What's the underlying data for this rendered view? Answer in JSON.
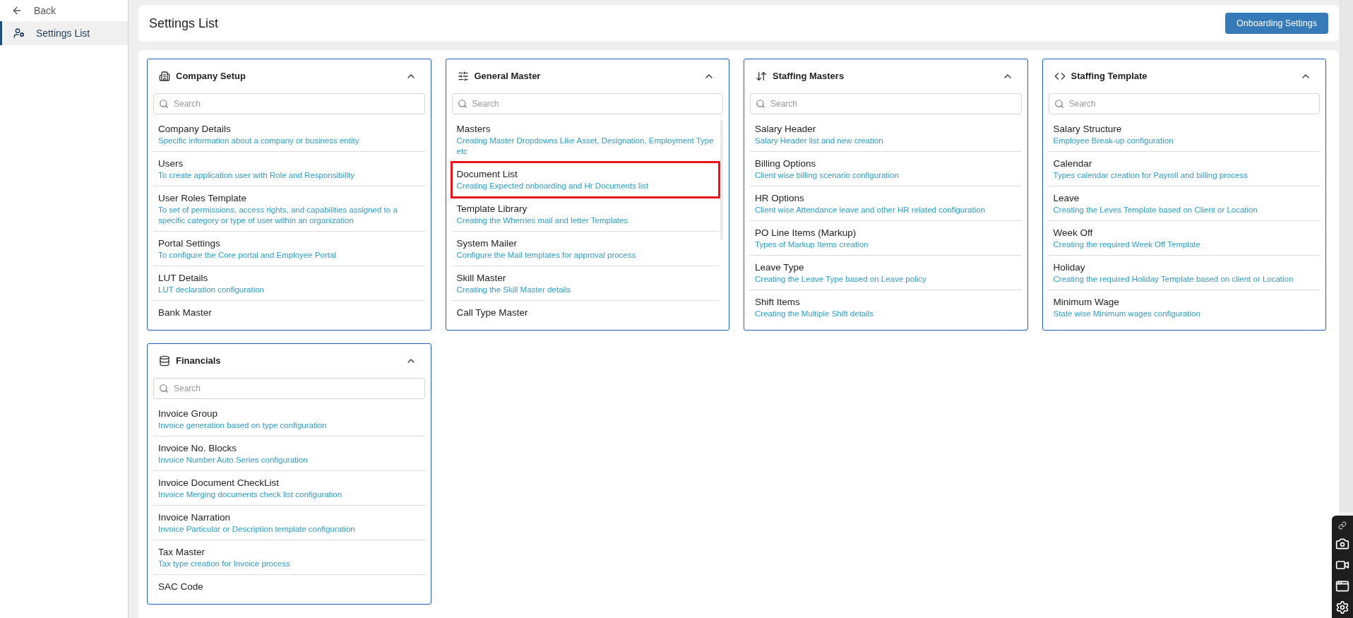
{
  "sidebar": {
    "back": "Back",
    "items": [
      {
        "label": "Settings List",
        "selected": true
      }
    ]
  },
  "header": {
    "title": "Settings List",
    "button": "Onboarding Settings"
  },
  "cards": [
    {
      "title": "Company Setup",
      "expanded": true,
      "scrollable": false,
      "search": {
        "placeholder": "Search"
      },
      "items": [
        {
          "title": "Company Details",
          "description": "Specific information about a company or business entity",
          "highlighted": false
        },
        {
          "title": "Users",
          "description": "To create application user with Role and Responsibility",
          "highlighted": false
        },
        {
          "title": "User Roles Template",
          "description": "To set of permissions, access rights, and capabilities assigned to a specific category or type of user within an organization",
          "highlighted": false
        },
        {
          "title": "Portal Settings",
          "description": "To configure the Core portal and Employee Portal",
          "highlighted": false
        },
        {
          "title": "LUT Details",
          "description": "LUT declaration configuration",
          "highlighted": false
        },
        {
          "title": "Bank Master",
          "highlighted": false
        }
      ]
    },
    {
      "title": "General Master",
      "expanded": true,
      "scrollable": true,
      "search": {
        "placeholder": "Search"
      },
      "items": [
        {
          "title": "Masters",
          "description": "Creating Master Dropdowns Like Asset, Designation, Employment Type etc",
          "highlighted": false
        },
        {
          "title": "Document List",
          "description": "Creating Expected onboarding and Hr Documents list",
          "highlighted": true
        },
        {
          "title": "Template Library",
          "description": "Creating the Wherries mail and letter Templates",
          "highlighted": false
        },
        {
          "title": "System Mailer",
          "description": "Configure the Mail templates for approval process",
          "highlighted": false
        },
        {
          "title": "Skill Master",
          "description": "Creating the Skill Master details",
          "highlighted": false
        },
        {
          "title": "Call Type Master",
          "highlighted": false
        }
      ]
    },
    {
      "title": "Staffing Masters",
      "expanded": true,
      "scrollable": false,
      "search": {
        "placeholder": "Search"
      },
      "items": [
        {
          "title": "Salary Header",
          "description": "Salary Header list and new creation",
          "highlighted": false
        },
        {
          "title": "Billing Options",
          "description": "Client wise billing scenario configuration",
          "highlighted": false
        },
        {
          "title": "HR Options",
          "description": "Client wise Attendance leave and other HR related configuration",
          "highlighted": false
        },
        {
          "title": "PO Line Items (Markup)",
          "description": "Types of Markup Items creation",
          "highlighted": false
        },
        {
          "title": "Leave Type",
          "description": "Creating the Leave Type based on Leave policy",
          "highlighted": false
        },
        {
          "title": "Shift Items",
          "description": "Creating the Multiple Shift details",
          "highlighted": false
        }
      ]
    },
    {
      "title": "Staffing Template",
      "expanded": true,
      "scrollable": false,
      "search": {
        "placeholder": "Search"
      },
      "items": [
        {
          "title": "Salary Structure",
          "description": "Employee Break-up configuration",
          "highlighted": false
        },
        {
          "title": "Calendar",
          "description": "Types calendar creation for Payroll and billing process",
          "highlighted": false
        },
        {
          "title": "Leave",
          "description": "Creating the Leves Template based on Client or Location",
          "highlighted": false
        },
        {
          "title": "Week Off",
          "description": "Creating the required Week Off Template",
          "highlighted": false
        },
        {
          "title": "Holiday",
          "description": "Creating the required Holiday Template based on client or Location",
          "highlighted": false
        },
        {
          "title": "Minimum Wage",
          "description": "State wise Minimum wages configuration",
          "highlighted": false
        }
      ]
    },
    {
      "title": "Financials",
      "expanded": true,
      "scrollable": false,
      "search": {
        "placeholder": "Search"
      },
      "items": [
        {
          "title": "Invoice Group",
          "description": "Invoice generation based on type configuration",
          "highlighted": false
        },
        {
          "title": "Invoice No. Blocks",
          "description": "Invoice Number Auto Series configuration",
          "highlighted": false
        },
        {
          "title": "Invoice Document CheckList",
          "description": "Invoice Merging documents check list configuration",
          "highlighted": false
        },
        {
          "title": "Invoice Narration",
          "description": "Invoice Particular or Description template configuration",
          "highlighted": false
        },
        {
          "title": "Tax Master",
          "description": "Tax type creation for Invoice process",
          "highlighted": false
        },
        {
          "title": "SAC Code",
          "highlighted": false
        }
      ]
    }
  ]
}
